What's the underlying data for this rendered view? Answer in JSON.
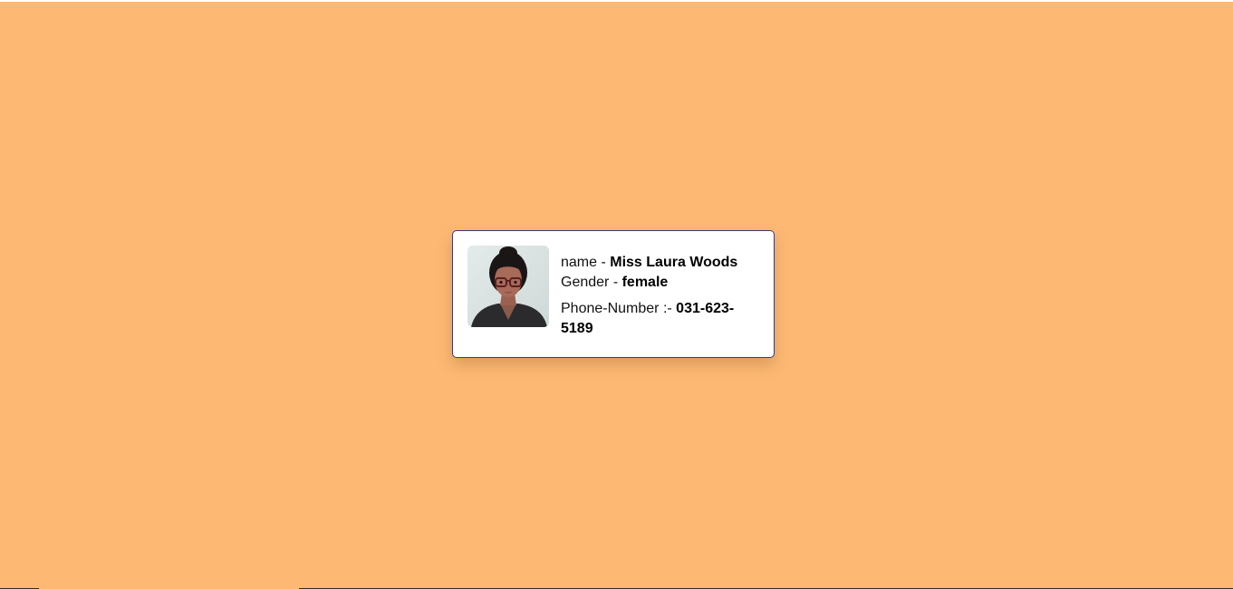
{
  "page": {
    "background_color": "#fdb974",
    "card_border_color": "#3d3a7a"
  },
  "user_card": {
    "avatar_alt": "Miss Laura Woods",
    "name_label": "name -",
    "name_value": "Miss Laura Woods",
    "gender_label": "Gender -",
    "gender_value": "female",
    "phone_label": "Phone-Number :-",
    "phone_value": "031-623-5189"
  }
}
